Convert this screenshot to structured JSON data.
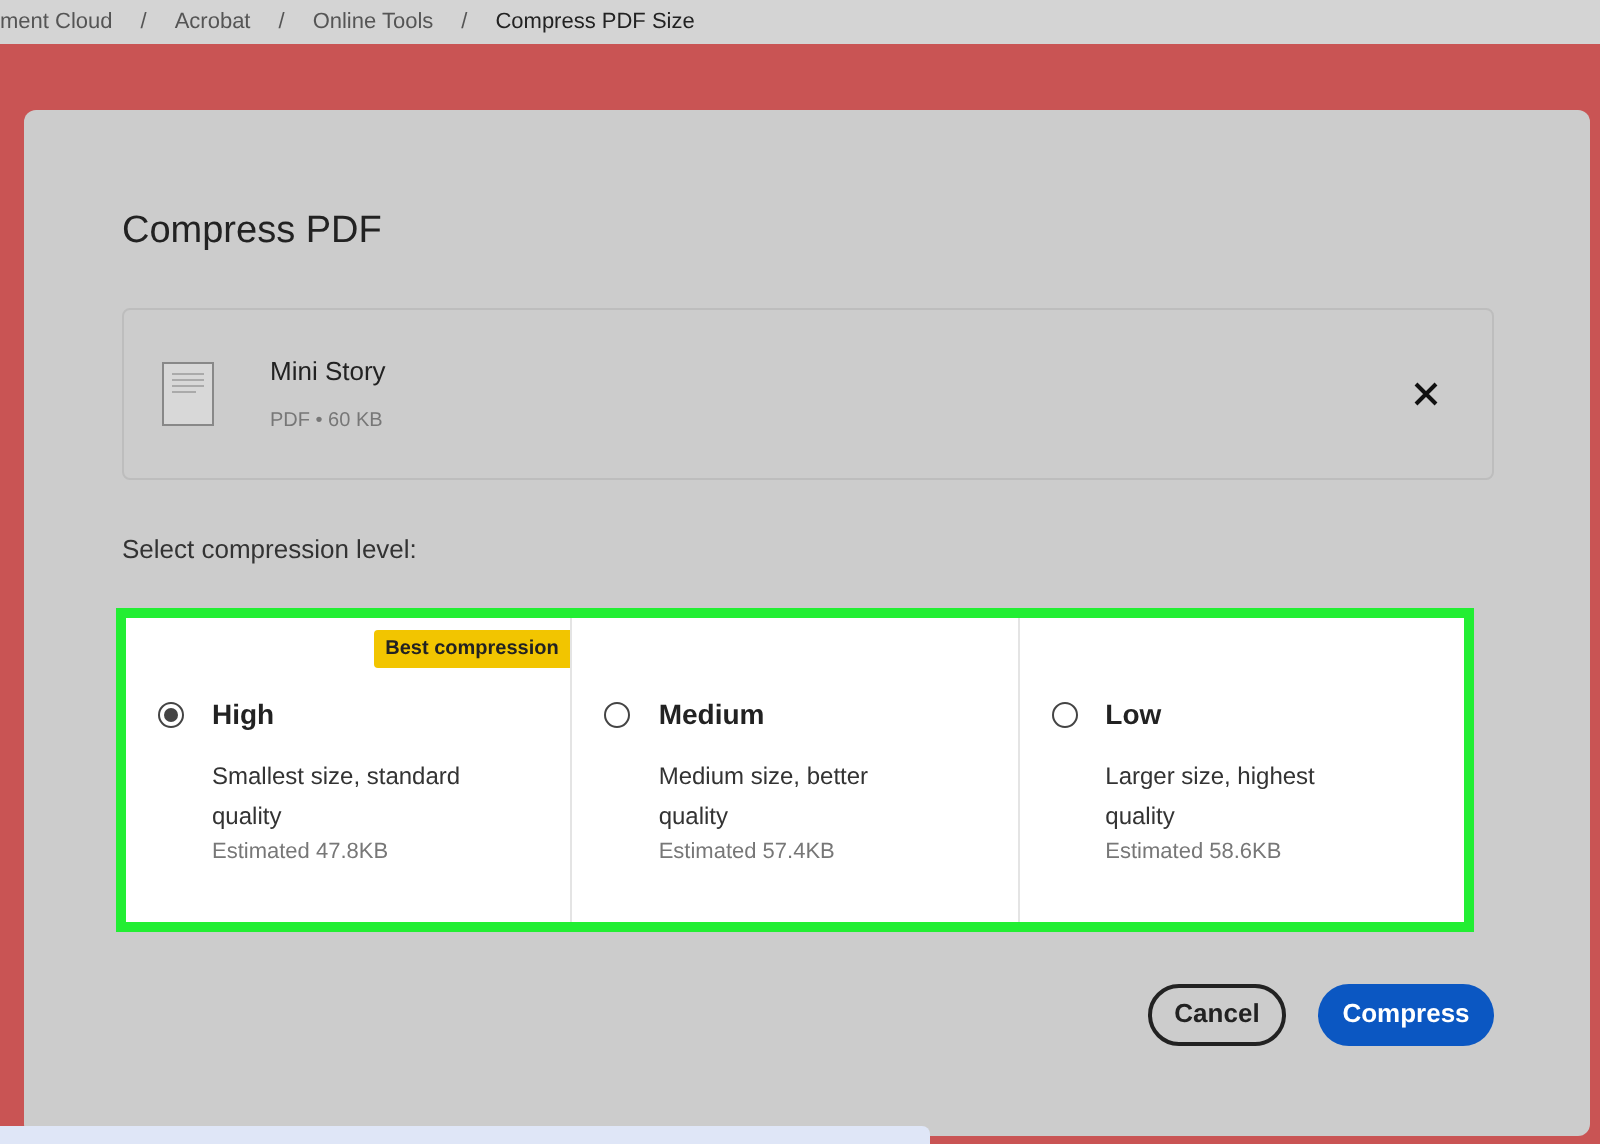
{
  "breadcrumb_separator": "/",
  "breadcrumb": [
    {
      "label": "ment Cloud",
      "current": false
    },
    {
      "label": "Acrobat",
      "current": false
    },
    {
      "label": "Online Tools",
      "current": false
    },
    {
      "label": "Compress PDF Size",
      "current": true
    }
  ],
  "dialog": {
    "title": "Compress PDF",
    "file": {
      "name": "Mini Story",
      "meta": "PDF • 60 KB"
    },
    "prompt": "Select compression level:",
    "options": [
      {
        "label": "High",
        "description": "Smallest size, standard quality",
        "estimate": "Estimated 47.8KB",
        "badge": "Best compression",
        "selected": true
      },
      {
        "label": "Medium",
        "description": "Medium size, better quality",
        "estimate": "Estimated 57.4KB",
        "selected": false
      },
      {
        "label": "Low",
        "description": "Larger size, highest quality",
        "estimate": "Estimated 58.6KB",
        "selected": false
      }
    ],
    "buttons": [
      {
        "label": "Cancel",
        "kind": "secondary"
      },
      {
        "label": "Compress",
        "kind": "primary"
      }
    ]
  }
}
